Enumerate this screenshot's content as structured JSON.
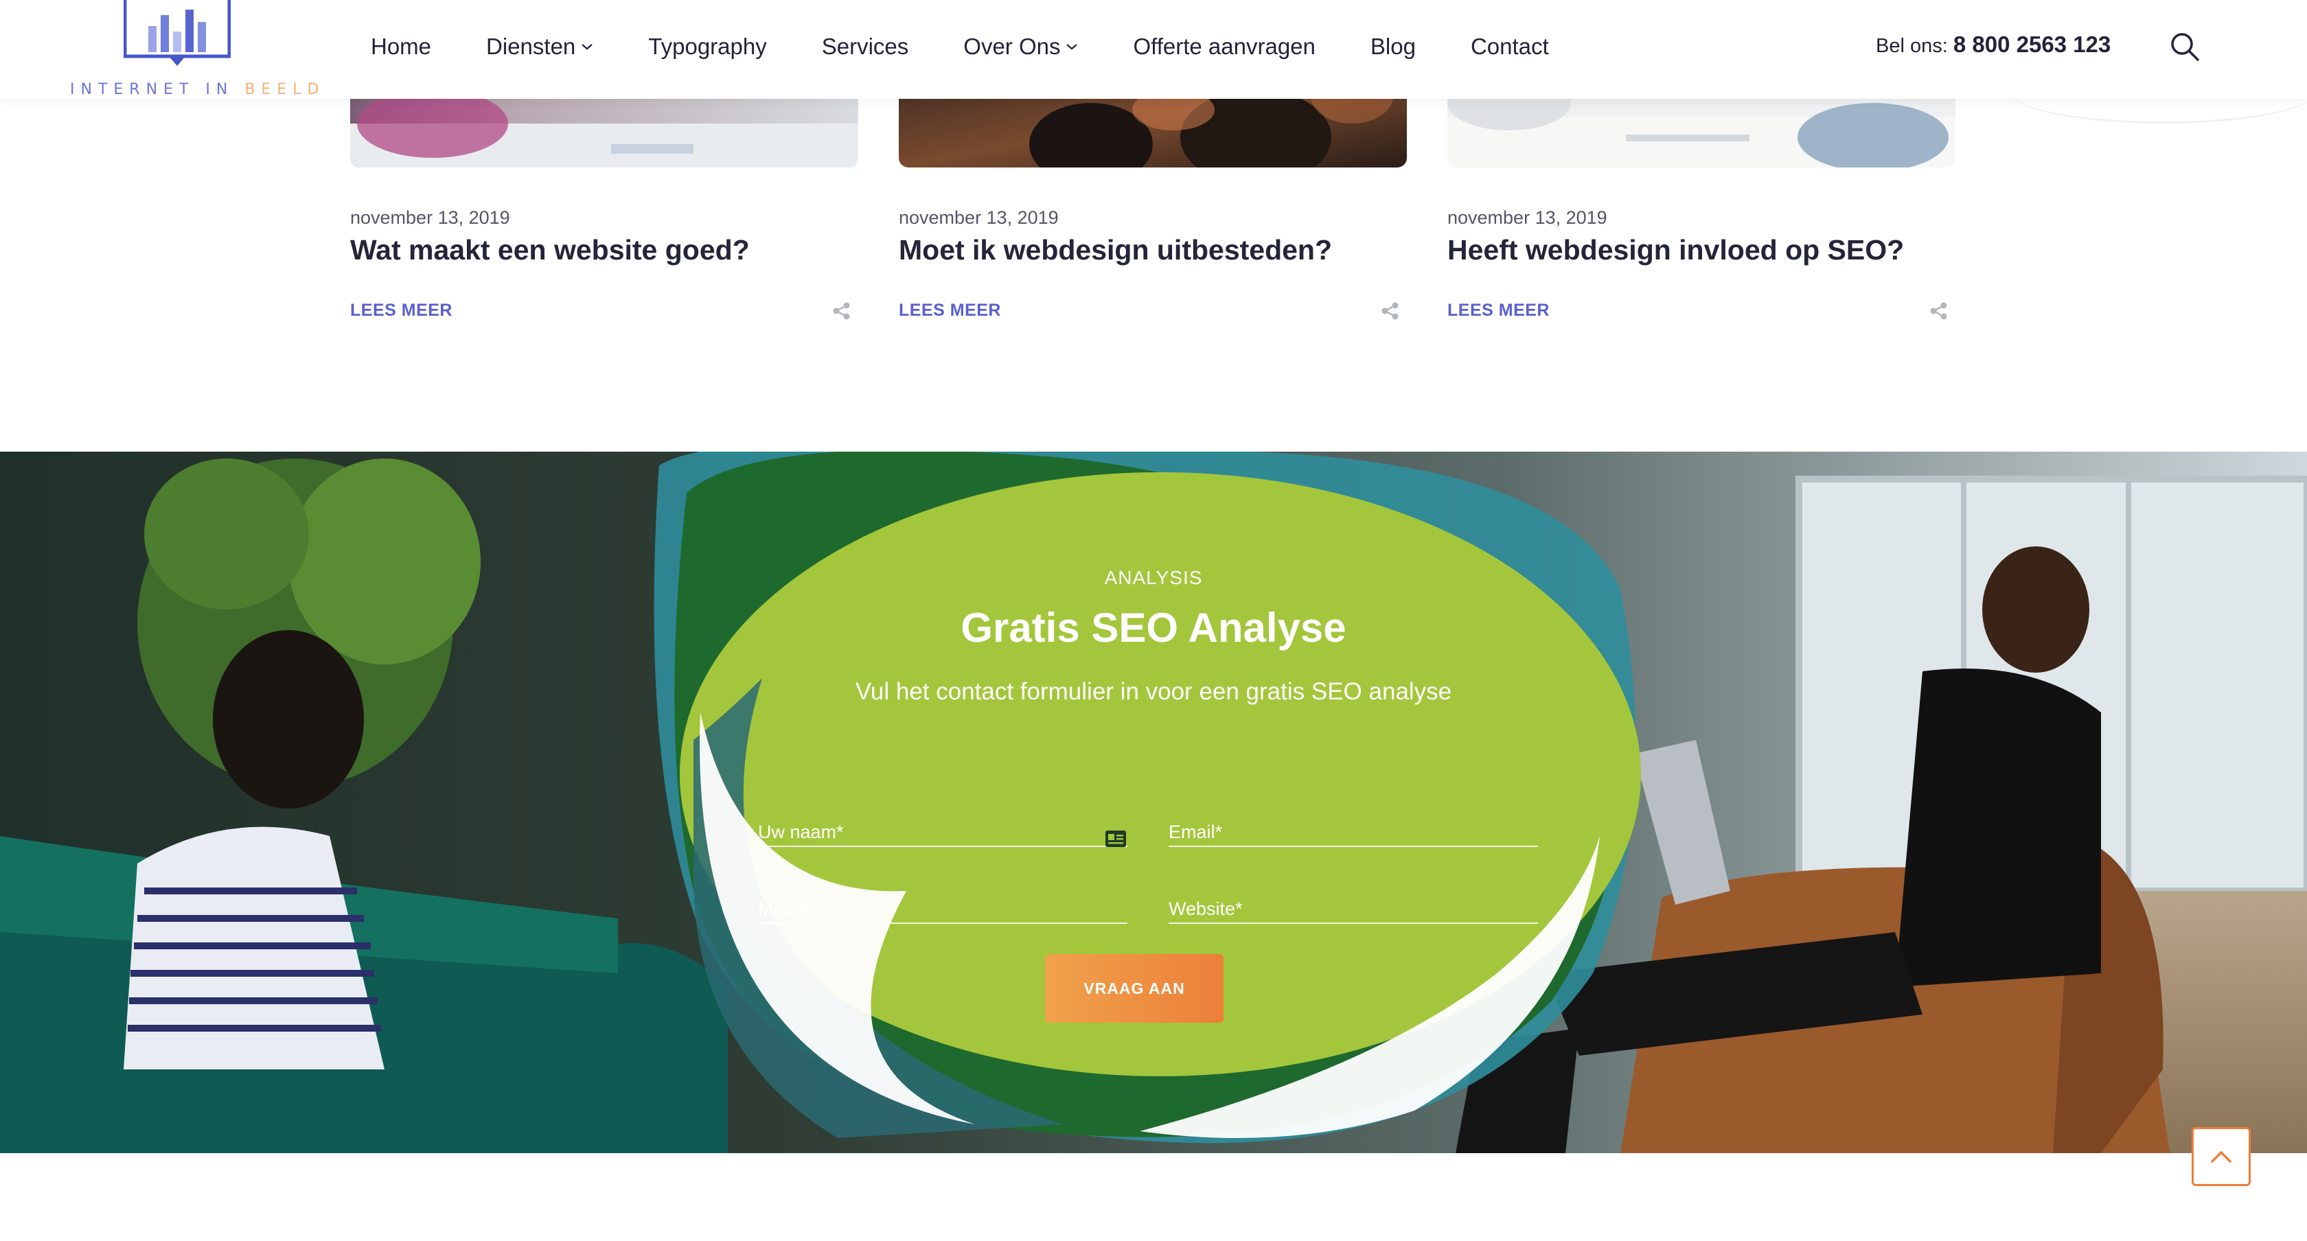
{
  "header": {
    "logo": {
      "text_main": "INTERNET IN ",
      "text_accent": "BEELD",
      "icon": "bar-chart-logo-icon"
    },
    "nav": [
      {
        "label": "Home",
        "has_dropdown": false
      },
      {
        "label": "Diensten",
        "has_dropdown": true
      },
      {
        "label": "Typography",
        "has_dropdown": false
      },
      {
        "label": "Services",
        "has_dropdown": false
      },
      {
        "label": "Over Ons",
        "has_dropdown": true
      },
      {
        "label": "Offerte aanvragen",
        "has_dropdown": false
      },
      {
        "label": "Blog",
        "has_dropdown": false
      },
      {
        "label": "Contact",
        "has_dropdown": false
      }
    ],
    "phone_label": "Bel ons:",
    "phone_number": "8 800 2563 123",
    "search_icon": "search-icon"
  },
  "blog": {
    "read_more_label": "LEES MEER",
    "posts": [
      {
        "date": "november 13, 2019",
        "title": "Wat maakt een website goed?"
      },
      {
        "date": "november 13, 2019",
        "title": "Moet ik webdesign uitbesteden?"
      },
      {
        "date": "november 13, 2019",
        "title": "Heeft webdesign invloed op SEO?"
      }
    ]
  },
  "analysis": {
    "eyebrow": "ANALYSIS",
    "title": "Gratis SEO Analyse",
    "subtitle": "Vul het contact formulier in voor een gratis SEO analyse",
    "fields": {
      "name_placeholder": "Uw naam*",
      "email_placeholder": "Email*",
      "mobile_placeholder": "Mobiel",
      "website_placeholder": "Website*"
    },
    "submit_label": "VRAAG AAN"
  },
  "colors": {
    "accent_purple": "#5a5fcf",
    "accent_orange": "#ec7f3a",
    "blob_green": "#a4c63c",
    "text_dark": "#23233a"
  }
}
